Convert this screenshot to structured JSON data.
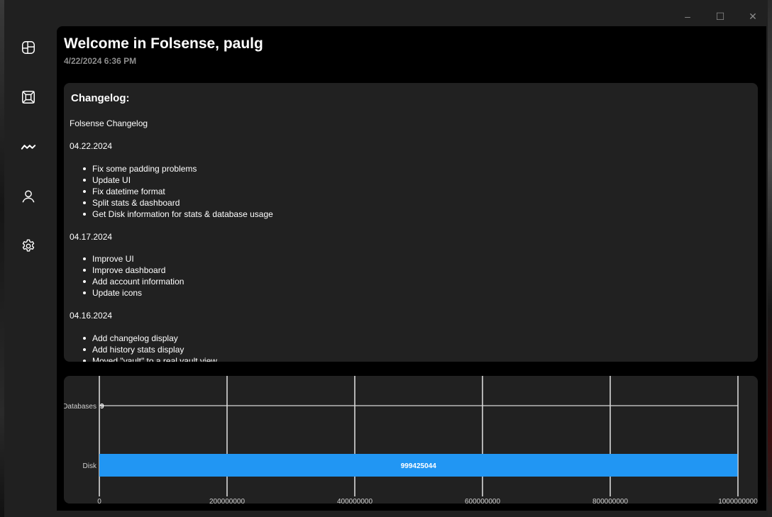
{
  "window": {
    "minimize_glyph": "–",
    "maximize_glyph": "☐",
    "close_glyph": "✕"
  },
  "sidebar": {
    "items": [
      {
        "icon": "dashboard-icon"
      },
      {
        "icon": "vault-icon"
      },
      {
        "icon": "activity-icon"
      },
      {
        "icon": "account-icon"
      },
      {
        "icon": "settings-icon"
      }
    ]
  },
  "header": {
    "welcome": "Welcome in Folsense, paulg",
    "datetime": "4/22/2024 6:36 PM"
  },
  "changelog": {
    "title": "Changelog:",
    "heading": "Folsense Changelog",
    "sections": [
      {
        "date": "04.22.2024",
        "items": [
          "Fix some padding problems",
          "Update UI",
          "Fix datetime format",
          "Split stats & dashboard",
          "Get Disk information for stats & database usage"
        ]
      },
      {
        "date": "04.17.2024",
        "items": [
          "Improve UI",
          "Improve dashboard",
          "Add account information",
          "Update icons"
        ]
      },
      {
        "date": "04.16.2024",
        "items": [
          "Add changelog display",
          "Add history stats display",
          "Moved \"vault\" to a real vault view"
        ]
      }
    ]
  },
  "colors": {
    "accent": "#2196f3",
    "card": "#212121",
    "content": "#000000"
  },
  "chart_data": {
    "type": "bar",
    "orientation": "horizontal",
    "categories": [
      "Databases",
      "Disk"
    ],
    "values": [
      9,
      999425044
    ],
    "data_labels": [
      "9",
      "999425044"
    ],
    "xlim": [
      0,
      1000000000
    ],
    "xticks": [
      0,
      200000000,
      400000000,
      600000000,
      800000000,
      1000000000
    ],
    "xtick_labels": [
      "0",
      "200000000",
      "400000000",
      "600000000",
      "800000000",
      "1000000000"
    ],
    "grid": true,
    "bar_color": "#2196f3"
  }
}
